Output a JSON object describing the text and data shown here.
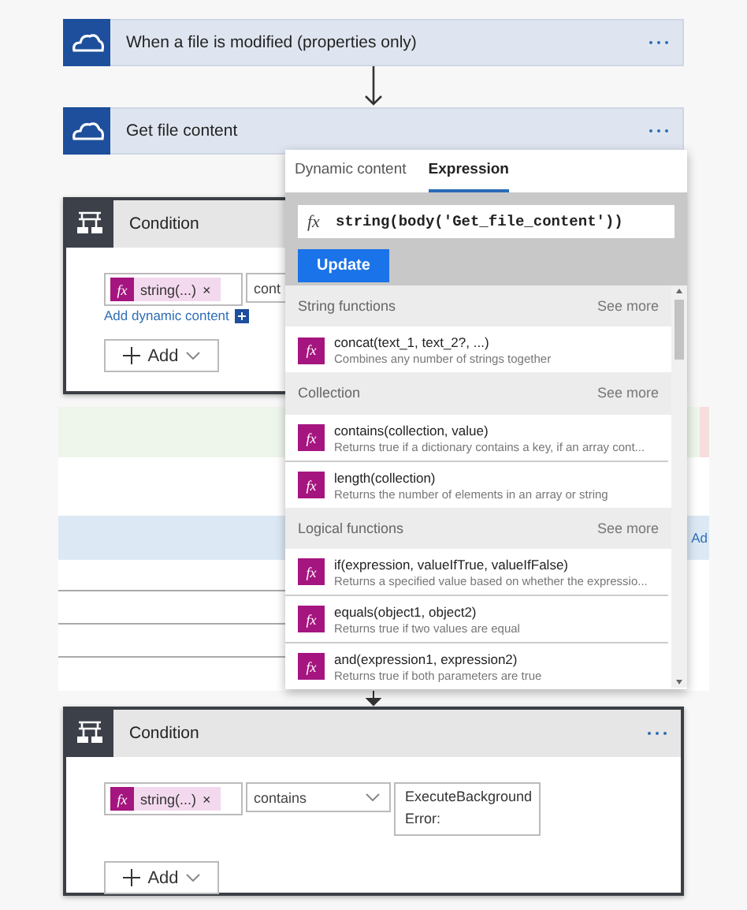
{
  "flow_steps": [
    {
      "title": "When a file is modified (properties only)"
    },
    {
      "title": "Get file content"
    }
  ],
  "condition_top": {
    "title": "Condition",
    "token": {
      "icon_text": "fx",
      "label": "string(...)",
      "remove": "×"
    },
    "operator": "cont",
    "link": "Add dynamic content",
    "add": "Add"
  },
  "hidden_branch": {
    "peek_text": "Ad"
  },
  "condition_bottom": {
    "title": "Condition",
    "token": {
      "icon_text": "fx",
      "label": "string(...)",
      "remove": "×"
    },
    "operator": "contains",
    "value_lines": [
      "ExecuteBackground",
      "Error:"
    ],
    "add": "Add"
  },
  "popup": {
    "tabs": [
      {
        "label": "Dynamic content",
        "selected": false
      },
      {
        "label": "Expression",
        "selected": true
      }
    ],
    "expression": {
      "icon_text": "fx",
      "value": "string(body('Get_file_content'))"
    },
    "button": "Update",
    "sections": [
      {
        "title": "String functions",
        "see_more": "See more",
        "functions": [
          {
            "icon_text": "fx",
            "signature": "concat(text_1, text_2?, ...)",
            "description": "Combines any number of strings together"
          }
        ]
      },
      {
        "title": "Collection",
        "see_more": "See more",
        "functions": [
          {
            "icon_text": "fx",
            "signature": "contains(collection, value)",
            "description": "Returns true if a dictionary contains a key, if an array cont..."
          },
          {
            "icon_text": "fx",
            "signature": "length(collection)",
            "description": "Returns the number of elements in an array or string"
          }
        ]
      },
      {
        "title": "Logical functions",
        "see_more": "See more",
        "functions": [
          {
            "icon_text": "fx",
            "signature": "if(expression, valueIfTrue, valueIfFalse)",
            "description": "Returns a specified value based on whether the expressio..."
          },
          {
            "icon_text": "fx",
            "signature": "equals(object1, object2)",
            "description": "Returns true if two values are equal"
          },
          {
            "icon_text": "fx",
            "signature": "and(expression1, expression2)",
            "description": "Returns true if both parameters are true"
          }
        ]
      }
    ]
  }
}
